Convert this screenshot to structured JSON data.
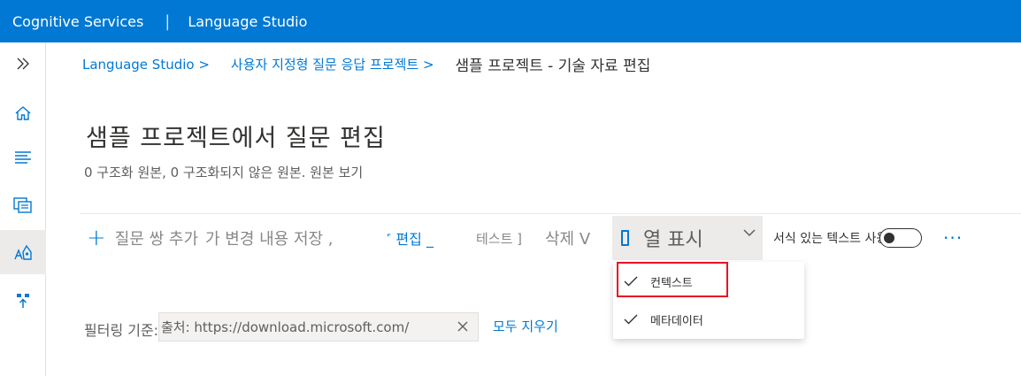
{
  "app": {
    "brand": "Cognitive Services",
    "product": "Language Studio"
  },
  "sidebar": {
    "items": [
      {
        "icon": "double-chevron-right-icon"
      },
      {
        "icon": "home-icon"
      },
      {
        "icon": "list-icon"
      },
      {
        "icon": "document-icon"
      },
      {
        "icon": "question-answering-icon",
        "active": true
      },
      {
        "icon": "deploy-icon"
      }
    ]
  },
  "breadcrumb": {
    "item1": "Language Studio >",
    "item2": "사용자 지정형 질문 응답 프로젝트 >",
    "current": "샘플 프로젝트 - 기술 자료 편집"
  },
  "page": {
    "title": "샘플 프로젝트에서 질문 편집",
    "subtitle": "0 구조화 원본, 0 구조화되지 않은 원본. 원본 보기"
  },
  "toolbar": {
    "add_label": "질문 쌍 추가",
    "save_label": "가 변경 내용 저장 ,",
    "edit_label": "˹ 편집 _",
    "test_label": "테스트 ]",
    "delete_label": "삭제 V",
    "columns_label": "열 표시",
    "rich_text_label": "서식 있는 텍스트 사용",
    "more_label": "···"
  },
  "dropdown": {
    "items": [
      {
        "label": "컨텍스트",
        "checked": true
      },
      {
        "label": "메타데이터",
        "checked": true
      }
    ]
  },
  "filter": {
    "label": "필터링 기준:",
    "value": "출처: https://download.microsoft.com/",
    "clear_all": "모두 지우기"
  },
  "colors": {
    "accent": "#0078d4",
    "highlight": "#e81123"
  }
}
